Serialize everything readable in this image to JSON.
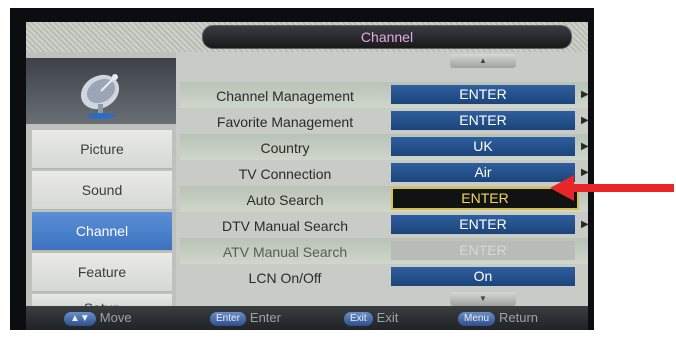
{
  "window": {
    "title": "Channel"
  },
  "sidebar": {
    "items": [
      {
        "label": "Picture"
      },
      {
        "label": "Sound"
      },
      {
        "label": "Channel"
      },
      {
        "label": "Feature"
      },
      {
        "label": "Setup"
      }
    ]
  },
  "scroll": {
    "up": "▲",
    "down": "▼"
  },
  "rows": [
    {
      "label": "Channel Management",
      "value": "ENTER",
      "arrow": "▶"
    },
    {
      "label": "Favorite Management",
      "value": "ENTER",
      "arrow": "▶"
    },
    {
      "label": "Country",
      "value": "UK",
      "arrow": "▶"
    },
    {
      "label": "TV Connection",
      "value": "Air",
      "arrow": "▶"
    },
    {
      "label": "Auto Search",
      "value": "ENTER",
      "arrow": ""
    },
    {
      "label": "DTV Manual Search",
      "value": "ENTER",
      "arrow": "▶"
    },
    {
      "label": "ATV Manual Search",
      "value": "ENTER",
      "arrow": ""
    },
    {
      "label": "LCN On/Off",
      "value": "On",
      "arrow": ""
    }
  ],
  "footer": {
    "move": {
      "key": "▲▼",
      "label": "Move"
    },
    "enter": {
      "key": "Enter",
      "label": "Enter"
    },
    "exit": {
      "key": "Exit",
      "label": "Exit"
    },
    "menu": {
      "key": "Menu",
      "label": "Return"
    }
  },
  "colors": {
    "title_text": "#e6a8e8",
    "active_tab": "#4a82cc",
    "pointer": "#e8262a"
  },
  "icons": {
    "logo": "satellite-dish-icon",
    "pointer": "red-arrow-icon"
  }
}
